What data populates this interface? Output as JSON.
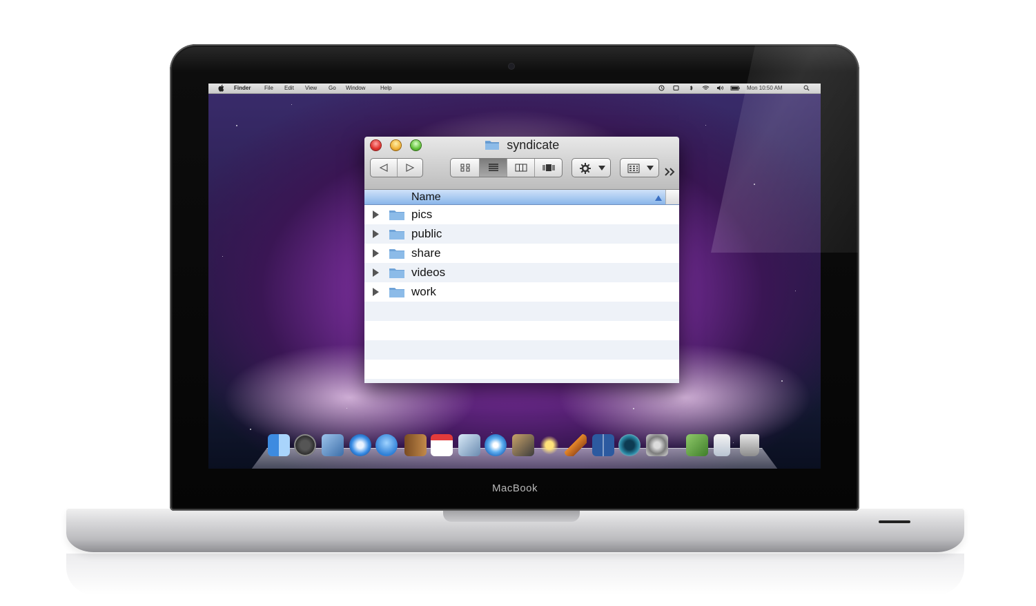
{
  "device": {
    "label": "MacBook"
  },
  "menubar": {
    "items": [
      "Finder",
      "File",
      "Edit",
      "View",
      "Go",
      "Window",
      "Help"
    ],
    "clock": "Mon 10:50 AM"
  },
  "window": {
    "title": "syndicate",
    "column_header": "Name",
    "folders": [
      {
        "name": "pics"
      },
      {
        "name": "public"
      },
      {
        "name": "share"
      },
      {
        "name": "videos"
      },
      {
        "name": "work"
      }
    ]
  },
  "dock": {
    "icons": [
      "finder-icon",
      "dashboard-icon",
      "mail-icon",
      "safari-icon",
      "ichat-icon",
      "address-book-icon",
      "ical-icon",
      "preview-icon",
      "itunes-icon",
      "iphoto-icon",
      "imovie-icon",
      "garageband-icon",
      "spaces-icon",
      "time-machine-icon",
      "system-preferences-icon",
      "documents-stack-icon",
      "downloads-stack-icon",
      "trash-icon"
    ]
  },
  "colors": {
    "header_blue": "#8ab6ea",
    "row_alt": "#eef2f8",
    "close": "#e0312c",
    "minimize": "#f0b43a",
    "zoom": "#62c23a"
  }
}
